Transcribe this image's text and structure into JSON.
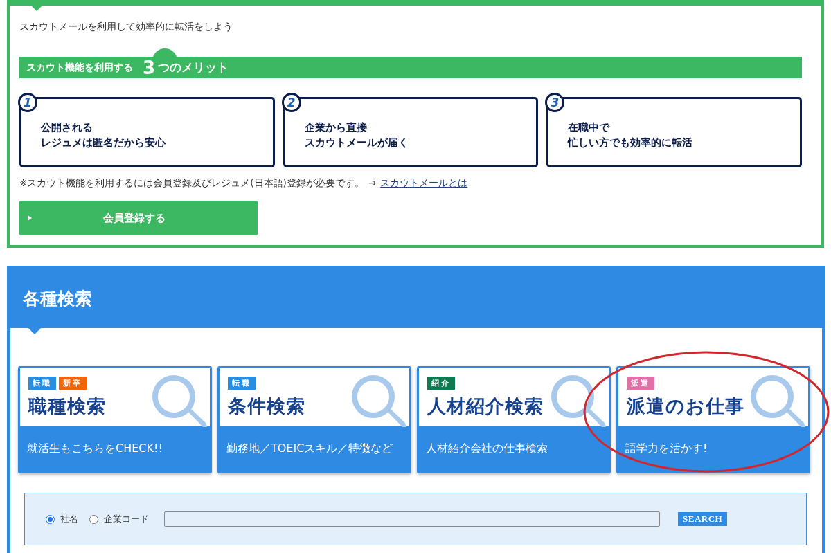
{
  "intro": "スカウトメールを利用して効率的に転活をしよう",
  "merits_banner": {
    "lead": "スカウト機能を利用する",
    "number": "3",
    "tail": "つのメリット"
  },
  "merits": [
    {
      "number": "1",
      "lines": [
        "公開される",
        "レジュメは匿名だから安心"
      ]
    },
    {
      "number": "2",
      "lines": [
        "企業から直接",
        "スカウトメールが届く"
      ]
    },
    {
      "number": "3",
      "lines": [
        "在職中で",
        "忙しい方でも効率的に転活"
      ]
    }
  ],
  "note": {
    "text": "※スカウト機能を利用するには会員登録及びレジュメ(日本語)登録が必要です。",
    "arrow": "→",
    "link": "スカウトメールとは"
  },
  "register_button": "会員登録する",
  "search_section": {
    "title": "各種検索",
    "cards": [
      {
        "tags": [
          {
            "label": "転職",
            "color": "#2a8ee0"
          },
          {
            "label": "新卒",
            "color": "#f0640c"
          }
        ],
        "title": "職種検索",
        "subtitle": "就活生もこちらをCHECK!!",
        "circled": false
      },
      {
        "tags": [
          {
            "label": "転職",
            "color": "#2a8ee0"
          }
        ],
        "title": "条件検索",
        "subtitle": "勤務地／TOEICスキル／特徴など",
        "circled": false
      },
      {
        "tags": [
          {
            "label": "紹介",
            "color": "#0f7a52"
          }
        ],
        "title": "人材紹介検索",
        "subtitle": "人材紹介会社の仕事検索",
        "circled": false
      },
      {
        "tags": [
          {
            "label": "派遣",
            "color": "#e070a8"
          }
        ],
        "title": "派遣のお仕事",
        "subtitle": "語学力を活かす!",
        "circled": true
      }
    ],
    "search_bar": {
      "options": [
        {
          "label": "社名",
          "selected": true
        },
        {
          "label": "企業コード",
          "selected": false
        }
      ],
      "button": "SEARCH"
    }
  }
}
